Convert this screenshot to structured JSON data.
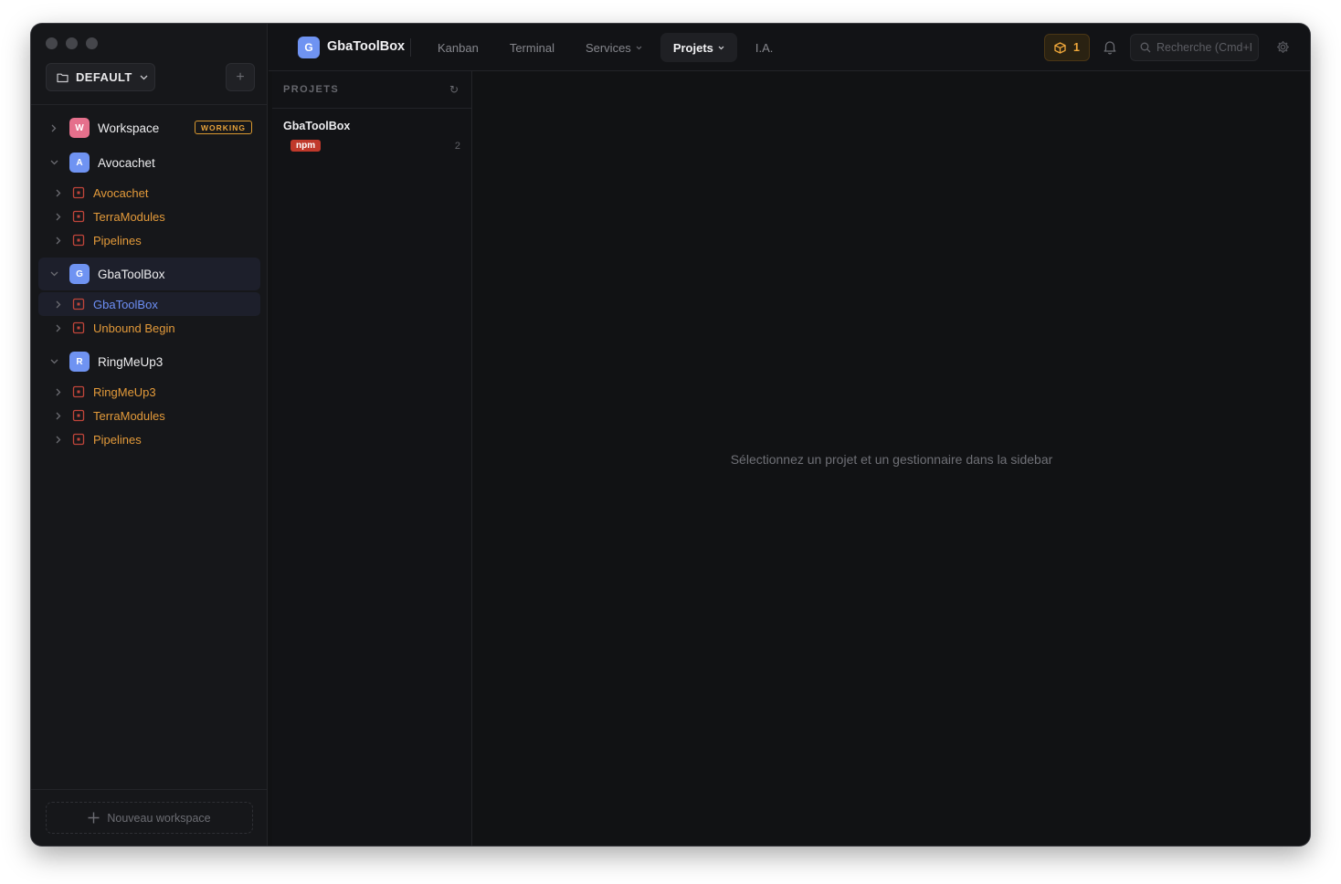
{
  "sidebar": {
    "workspace_selector": "DEFAULT",
    "add_button": "+",
    "workspaces": [
      {
        "initial": "W",
        "name": "Workspace",
        "color": "#e5708c",
        "badge": "WORKING",
        "expanded": false,
        "projects": []
      },
      {
        "initial": "A",
        "name": "Avocachet",
        "color": "#6f93f2",
        "expanded": true,
        "projects": [
          {
            "name": "Avocachet"
          },
          {
            "name": "TerraModules"
          },
          {
            "name": "Pipelines"
          }
        ]
      },
      {
        "initial": "G",
        "name": "GbaToolBox",
        "color": "#6f93f2",
        "expanded": true,
        "active": true,
        "projects": [
          {
            "name": "GbaToolBox",
            "active": true
          },
          {
            "name": "Unbound Begin"
          }
        ]
      },
      {
        "initial": "R",
        "name": "RingMeUp3",
        "color": "#6f93f2",
        "expanded": true,
        "projects": [
          {
            "name": "RingMeUp3"
          },
          {
            "name": "TerraModules"
          },
          {
            "name": "Pipelines"
          }
        ]
      }
    ],
    "new_workspace": "Nouveau workspace"
  },
  "header": {
    "app_initial": "G",
    "app_name": "GbaToolBox",
    "nav": [
      {
        "label": "Kanban",
        "dropdown": false,
        "active": false
      },
      {
        "label": "Terminal",
        "dropdown": false,
        "active": false
      },
      {
        "label": "Services",
        "dropdown": true,
        "active": false
      },
      {
        "label": "Projets",
        "dropdown": true,
        "active": true
      },
      {
        "label": "I.A.",
        "dropdown": false,
        "active": false
      }
    ],
    "notifications_count": "1",
    "search_placeholder": "Recherche (Cmd+K)"
  },
  "projects_pane": {
    "title": "PROJETS",
    "refresh_icon": "↻",
    "items": [
      {
        "name": "GbaToolBox",
        "tag": "npm",
        "count": "2"
      }
    ]
  },
  "main": {
    "empty_message": "Sélectionnez un projet et un gestionnaire dans la sidebar"
  },
  "colors": {
    "accent": "#6f93f2",
    "project_text": "#e39a3a",
    "active_project_text": "#6d8ff5",
    "badge_working": "#e7a23a",
    "npm_tag": "#c0392b"
  }
}
